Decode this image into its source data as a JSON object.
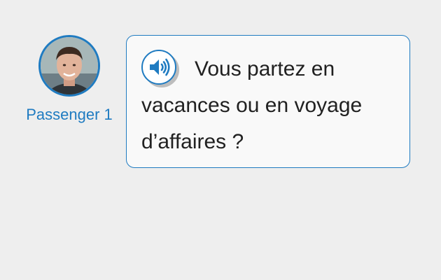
{
  "speaker": {
    "name": "Passenger 1",
    "avatar_icon": "person-photo-icon"
  },
  "bubble": {
    "audio_icon": "speaker-volume-icon",
    "text": "Vous partez en vacances ou en voyage d’affaires ?"
  },
  "colors": {
    "accent": "#1f7bc1",
    "background": "#eeeeee",
    "bubble_bg": "#f9f9f9",
    "text": "#212121"
  }
}
